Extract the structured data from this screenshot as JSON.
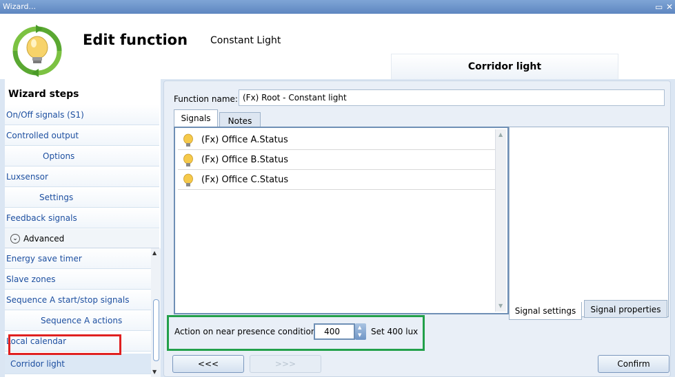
{
  "window": {
    "title": "Wizard...",
    "restore_icon": "restore-icon",
    "close_icon": "close-icon"
  },
  "header": {
    "title": "Edit function",
    "subtitle": "Constant Light",
    "tab_label": "Corridor light",
    "logo_icon": "lightbulb-cycle-icon"
  },
  "sidebar": {
    "title": "Wizard steps",
    "items": [
      {
        "label": "On/Off signals (S1)"
      },
      {
        "label": "Controlled output"
      },
      {
        "label": "Options"
      },
      {
        "label": "Luxsensor"
      },
      {
        "label": "Settings"
      },
      {
        "label": "Feedback signals"
      }
    ],
    "advanced_label": "Advanced",
    "advanced_items": [
      {
        "label": "Energy save timer"
      },
      {
        "label": "Slave zones"
      },
      {
        "label": "Sequence A start/stop signals"
      },
      {
        "label": "Sequence A actions"
      },
      {
        "label": "Local calendar"
      },
      {
        "label": "Corridor light"
      }
    ]
  },
  "main": {
    "function_name_label": "Function name:",
    "function_name_value": "(Fx) Root - Constant light",
    "tabs": [
      {
        "label": "Signals"
      },
      {
        "label": "Notes"
      }
    ],
    "signals": [
      {
        "label": "(Fx) Office A.Status",
        "icon": "bulb-icon"
      },
      {
        "label": "(Fx) Office B.Status",
        "icon": "bulb-icon"
      },
      {
        "label": "(Fx) Office C.Status",
        "icon": "bulb-icon"
      }
    ],
    "signal_tabs": [
      {
        "label": "Signal settings"
      },
      {
        "label": "Signal properties"
      }
    ],
    "action_label": "Action on near presence condition",
    "action_value": "400",
    "action_set_label": "Set 400 lux"
  },
  "buttons": {
    "prev": "<<<",
    "next": ">>>",
    "confirm": "Confirm"
  },
  "colors": {
    "link": "#1d4fa0",
    "highlight_red": "#e02020",
    "highlight_green": "#22a04a",
    "titlebar": "#6a90c8"
  }
}
